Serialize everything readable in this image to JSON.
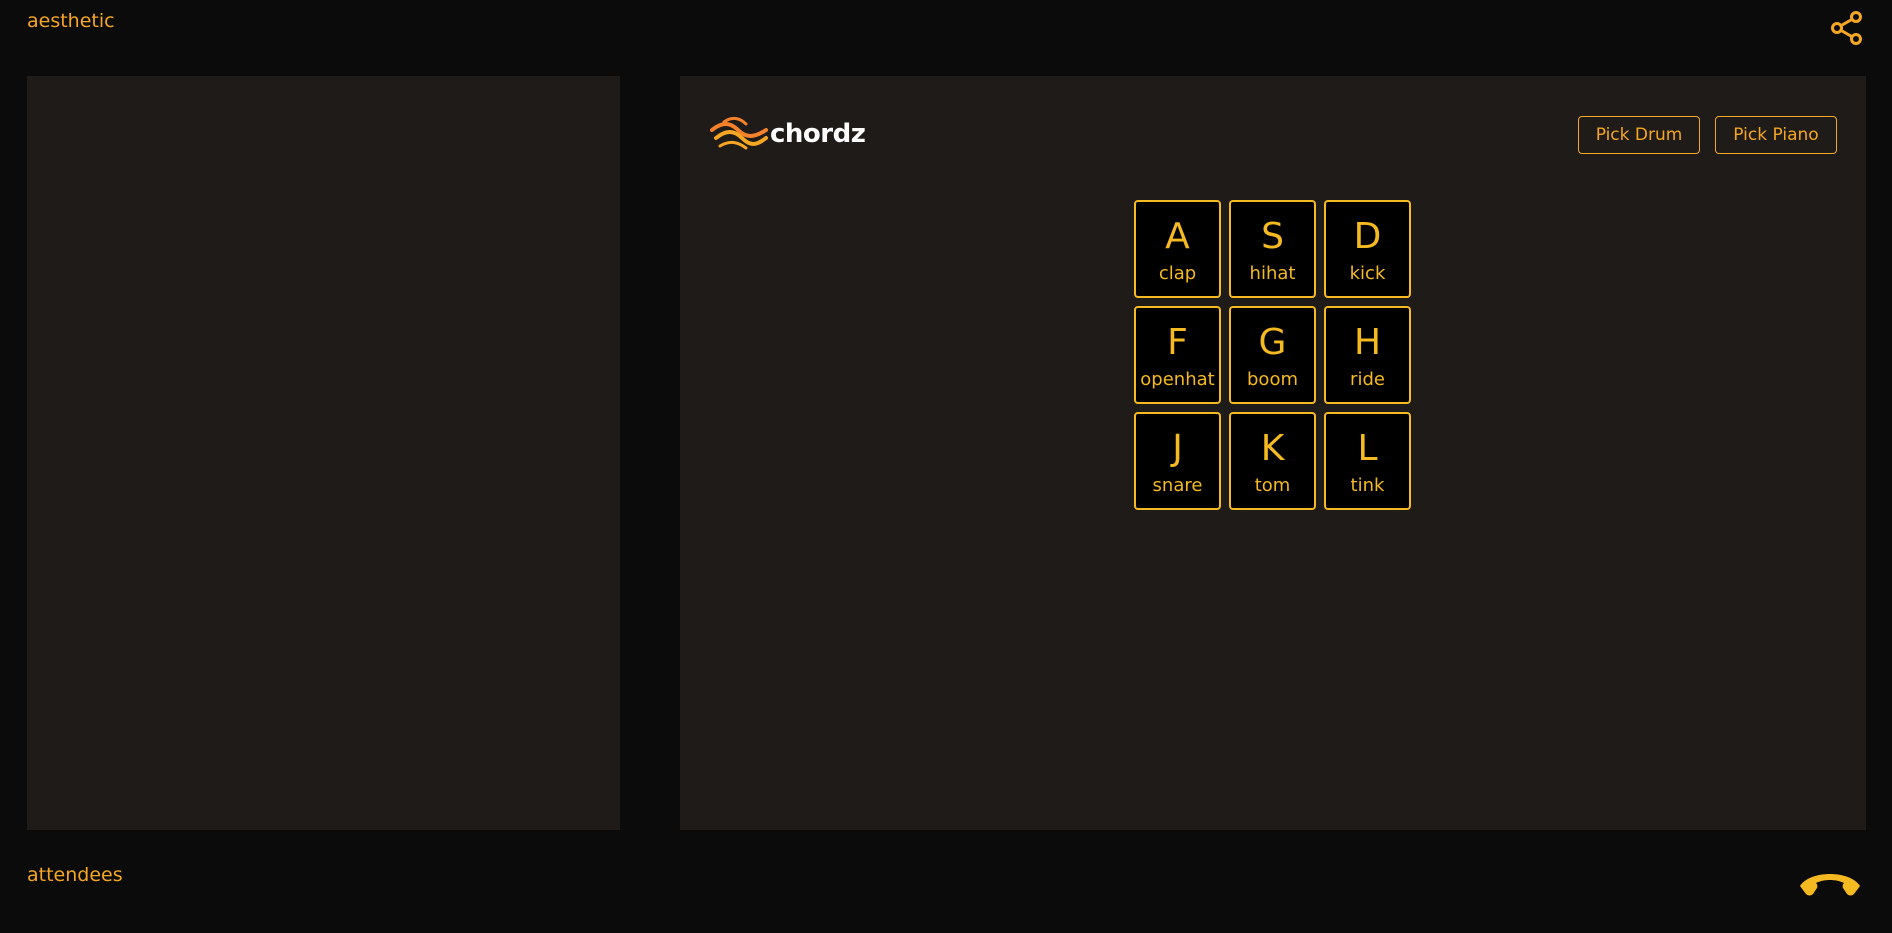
{
  "header": {
    "room_name": "aesthetic",
    "share_icon": "share-icon"
  },
  "logo": {
    "text": "chordz",
    "icon": "wave-logo-icon"
  },
  "toolbar": {
    "pick_drum_label": "Pick Drum",
    "pick_piano_label": "Pick Piano"
  },
  "pads": [
    {
      "key": "A",
      "sound": "clap"
    },
    {
      "key": "S",
      "sound": "hihat"
    },
    {
      "key": "D",
      "sound": "kick"
    },
    {
      "key": "F",
      "sound": "openhat"
    },
    {
      "key": "G",
      "sound": "boom"
    },
    {
      "key": "H",
      "sound": "ride"
    },
    {
      "key": "J",
      "sound": "snare"
    },
    {
      "key": "K",
      "sound": "tom"
    },
    {
      "key": "L",
      "sound": "tink"
    }
  ],
  "footer": {
    "attendees_label": "attendees",
    "hangup_icon": "hang-up-phone-icon"
  },
  "colors": {
    "background": "#0b0b0b",
    "panel": "#1f1b18",
    "accent": "#f5a623",
    "pad_border": "#f5b921",
    "pad_fill": "#000000",
    "logo_text": "#ffffff"
  }
}
